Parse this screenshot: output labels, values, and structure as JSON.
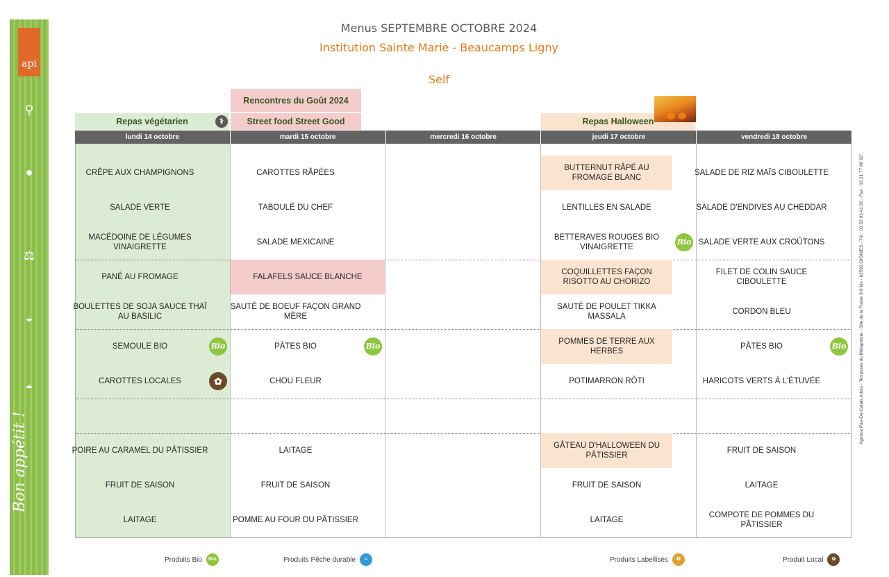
{
  "header": {
    "title": "Menus SEPTEMBRE OCTOBRE 2024",
    "institution": "Institution Sainte Marie - Beaucamps Ligny",
    "section": "Self"
  },
  "themes": {
    "vegetarian": "Repas végétarien",
    "gout_top": "Rencontres du Goût 2024",
    "gout_bottom": "Street food Street Good",
    "halloween": "Repas Halloween"
  },
  "days": [
    "lundi 14 octobre",
    "mardi 15 octobre",
    "mercredi 16 octobre",
    "jeudi 17 octobre",
    "vendredi 18 octobre"
  ],
  "menu": {
    "monday": [
      "CRÊPE AUX CHAMPIGNONS",
      "SALADE VERTE",
      "MACÉDOINE DE LÉGUMES VINAIGRETTE",
      "PANÉ AU FROMAGE",
      "BOULETTES DE SOJA SAUCE THAÏ AU BASILIC",
      "SEMOULE BIO",
      "CAROTTES LOCALES",
      "",
      "POIRE AU CARAMEL DU PÂTISSIER",
      "FRUIT DE SAISON",
      "LAITAGE"
    ],
    "tuesday": [
      "CAROTTES RÂPÉES",
      "TABOULÉ DU CHEF",
      "SALADE MEXICAINE",
      "FALAFELS SAUCE BLANCHE",
      "SAUTÉ DE BOEUF FAÇON GRAND MÈRE",
      "PÂTES BIO",
      "CHOU FLEUR",
      "",
      "LAITAGE",
      "FRUIT DE SAISON",
      "POMME AU FOUR DU PÂTISSIER"
    ],
    "thursday": [
      "BUTTERNUT RÂPÉ AU FROMAGE BLANC",
      "LENTILLES EN SALADE",
      "BETTERAVES ROUGES BIO VINAIGRETTE",
      "COQUILLETTES FAÇON RISOTTO AU CHORIZO",
      "SAUTÉ DE POULET TIKKA MASSALA",
      "POMMES DE TERRE AUX HERBES",
      "POTIMARRON RÔTI",
      "",
      "GÂTEAU D'HALLOWEEN DU PÂTISSIER",
      "FRUIT DE SAISON",
      "LAITAGE"
    ],
    "friday": [
      "SALADE DE RIZ MAÏS CIBOULETTE",
      "SALADE D'ENDIVES AU CHEDDAR",
      "SALADE VERTE AUX CROÛTONS",
      "FILET DE COLIN SAUCE CIBOULETTE",
      "CORDON BLEU",
      "PÂTES BIO",
      "HARICOTS VERTS À L'ÉTUVÉE",
      "",
      "FRUIT DE SAISON",
      "LAITAGE",
      "COMPOTE DE POMMES DU PÂTISSIER"
    ]
  },
  "badges": {
    "bio": "Bio",
    "local": "✿"
  },
  "legend": {
    "bio": "Produits Bio",
    "peche": "Produits Pêche durable",
    "labellises": "Produits Labellisés",
    "local": "Produit Local"
  },
  "side_address": "Agence Pas-De-Calais Artois - Terrasses du Métaphone - Site de la Fosse 9-9 bis - 62590 OIGNIES - Tél : 03 52 03 41 80 - Fax : 03 21 77 80 92\"",
  "logo": "api",
  "strip_text": "Bon appétit !",
  "colors": {
    "vegetarian_bg": "#dcebd3",
    "gout_bg": "#f4cccc",
    "halloween_bg": "#fbe4cf",
    "accent_orange": "#e07a1f",
    "bio_green": "#8dc63f",
    "day_header_bg": "#636363"
  }
}
